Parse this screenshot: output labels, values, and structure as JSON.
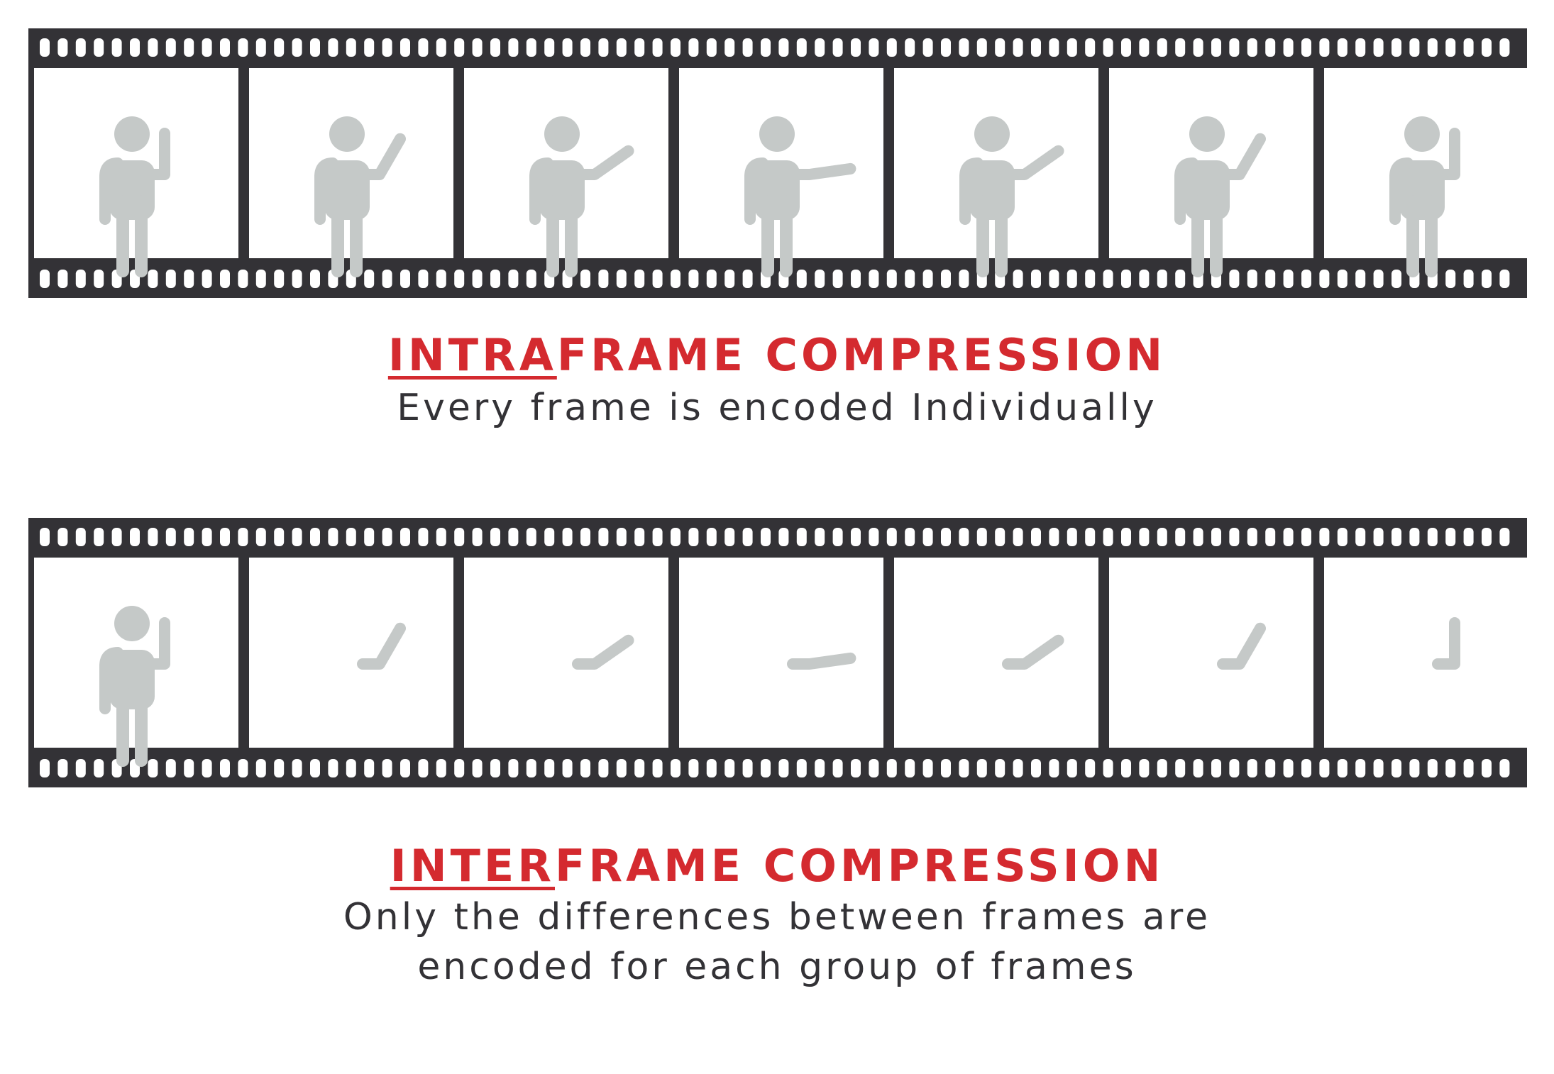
{
  "colors": {
    "film": "#333236",
    "frame_background": "#ffffff",
    "figure": "#c5c9c8",
    "heading": "#d42a2f",
    "body_text": "#333236"
  },
  "sections": [
    {
      "id": "intraframe",
      "heading_prefix": "INTRA",
      "heading_rest": "FRAME COMPRESSION",
      "description": [
        "Every frame is encoded Individually"
      ],
      "frames": [
        {
          "content": "full-figure",
          "arm_angle_deg": 90
        },
        {
          "content": "full-figure",
          "arm_angle_deg": 60
        },
        {
          "content": "full-figure",
          "arm_angle_deg": 35
        },
        {
          "content": "full-figure",
          "arm_angle_deg": 8
        },
        {
          "content": "full-figure",
          "arm_angle_deg": 35
        },
        {
          "content": "full-figure",
          "arm_angle_deg": 60
        },
        {
          "content": "full-figure",
          "arm_angle_deg": 90
        }
      ]
    },
    {
      "id": "interframe",
      "heading_prefix": "INTER",
      "heading_rest": "FRAME COMPRESSION",
      "description": [
        "Only the differences between frames are",
        "encoded for each group of frames"
      ],
      "frames": [
        {
          "content": "full-figure",
          "arm_angle_deg": 90
        },
        {
          "content": "arm-only",
          "arm_angle_deg": 60
        },
        {
          "content": "arm-only",
          "arm_angle_deg": 35
        },
        {
          "content": "arm-only",
          "arm_angle_deg": 8
        },
        {
          "content": "arm-only",
          "arm_angle_deg": 35
        },
        {
          "content": "arm-only",
          "arm_angle_deg": 60
        },
        {
          "content": "arm-only",
          "arm_angle_deg": 90
        }
      ]
    }
  ]
}
